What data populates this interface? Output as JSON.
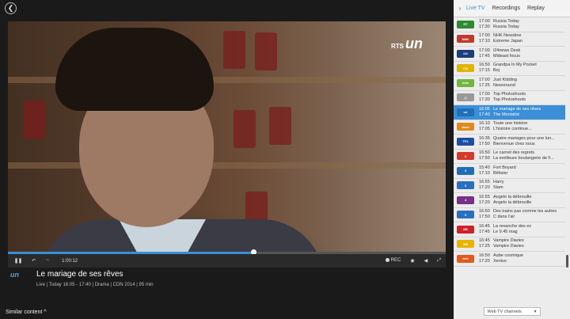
{
  "player": {
    "back_icon": "chevron-left-icon",
    "channel_logo_small": "RTS",
    "channel_logo_big": "un",
    "progress_fraction": 0.56,
    "controls": {
      "pause_icon": "❚❚",
      "rewind_icon": "↶",
      "forward_icon": "↷",
      "time": "1:00:12",
      "rec_label": "REC",
      "volume_icon": "◀",
      "fullscreen_icon": "⤢"
    }
  },
  "program": {
    "channel_logo": "un",
    "title": "Le mariage de ses rêves",
    "meta": "Live | Today 16:05 - 17:40 | Drama | CDN 2014 | 95 min"
  },
  "similar_label": "Similar content ^",
  "panel": {
    "collapse_icon": "›",
    "tabs": [
      {
        "label": "Live TV",
        "active": true
      },
      {
        "label": "Recordings",
        "active": false
      },
      {
        "label": "Replay",
        "active": false
      }
    ],
    "footer_select": "Web TV channels",
    "channels": [
      {
        "logo": "RT",
        "color": "#2e8b2e",
        "t1": "17:00",
        "t2": "17:30",
        "s1": "Russia Today",
        "s2": "Russia Today"
      },
      {
        "logo": "NHK",
        "color": "#c0392b",
        "t1": "17:00",
        "t2": "17:10",
        "s1": "NHK Newsline",
        "s2": "Extreme Japan"
      },
      {
        "logo": "i24",
        "color": "#1a3f7a",
        "t1": "17:00",
        "t2": "17:45",
        "s1": "i24news Desk",
        "s2": "Mideast focus"
      },
      {
        "logo": "CN",
        "color": "#e0b400",
        "t1": "16:50",
        "t2": "17:15",
        "s1": "Grandpa In My Pocket",
        "s2": "Boj"
      },
      {
        "logo": "kids",
        "color": "#6fb73d",
        "t1": "17:00",
        "t2": "17:25",
        "s1": "Just Kidding",
        "s2": "Newsround"
      },
      {
        "logo": "◇",
        "color": "#999999",
        "t1": "17:00",
        "t2": "17:30",
        "s1": "Top Photoshoots",
        "s2": "Top Photoshoots"
      },
      {
        "logo": "un",
        "color": "#1f6fb8",
        "t1": "16:05",
        "t2": "17:40",
        "s1": "Le mariage de ses rêves",
        "s2": "The Mentalist",
        "active": true
      },
      {
        "logo": "deux",
        "color": "#e08a1e",
        "t1": "16:10",
        "t2": "17:05",
        "s1": "Toute une histoire",
        "s2": "L'histoire continue..."
      },
      {
        "logo": "TF1",
        "color": "#1c4fa1",
        "t1": "16:35",
        "t2": "17:50",
        "s1": "Quatre mariages pour une lun...",
        "s2": "Bienvenue chez nous"
      },
      {
        "logo": "2",
        "color": "#d23a2a",
        "t1": "16:50",
        "t2": "17:50",
        "s1": "Le carnet des regrets",
        "s2": "La meilleure boulangerie de F..."
      },
      {
        "logo": "3",
        "color": "#1f6fb8",
        "t1": "15:40",
        "t2": "17:10",
        "s1": "Fort Boyard",
        "s2": "Bêtisier"
      },
      {
        "logo": "5",
        "color": "#2a6fc0",
        "t1": "16:55",
        "t2": "17:20",
        "s1": "Harry",
        "s2": "Slam"
      },
      {
        "logo": "4",
        "color": "#7a2f8a",
        "t1": "16:55",
        "t2": "17:20",
        "s1": "Angelo la débrouille",
        "s2": "Angelo la débrouille"
      },
      {
        "logo": "5",
        "color": "#2a6fc0",
        "t1": "16:50",
        "t2": "17:50",
        "s1": "Des trains pas comme les autres",
        "s2": "C dans l'air"
      },
      {
        "logo": "M6",
        "color": "#d0202a",
        "t1": "16:45",
        "t2": "17:45",
        "s1": "La revanche des ex",
        "s2": "Le 9.45 mag"
      },
      {
        "logo": "W9",
        "color": "#e8b400",
        "t1": "16:45",
        "t2": "17:25",
        "s1": "Vampire Diaries",
        "s2": "Vampire Diaries"
      },
      {
        "logo": "arte",
        "color": "#e25a1c",
        "t1": "16:50",
        "t2": "17:20",
        "s1": "Aube cosmique",
        "s2": "Xenius"
      }
    ]
  }
}
